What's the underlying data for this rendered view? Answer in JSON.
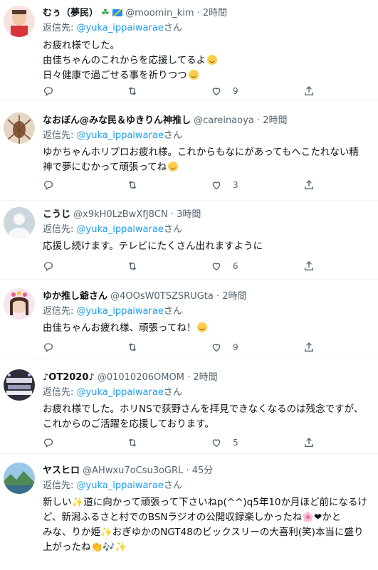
{
  "tweets": [
    {
      "name": "むぅ（夢民）",
      "handle": "@moomin_kim",
      "time": "2時間",
      "reply_prefix": "返信先:",
      "reply_handle": "@yuka_ippaiwarae",
      "reply_suffix": "さん",
      "lines": [
        "お疲れ様でした。",
        "由佳ちゃんのこれからを応援してるよ",
        "日々健康で過ごせる事を祈りつつ"
      ],
      "like_count": "9",
      "avatar_color": "#d9343c"
    },
    {
      "name": "なおぼん@みな民＆ゆきりん神推し",
      "handle": "@careinaoya",
      "time": "2時間",
      "reply_prefix": "返信先:",
      "reply_handle": "@yuka_ippaiwarae",
      "reply_suffix": "さん",
      "lines": [
        "ゆかちゃんホリプロお疲れ様。これからもなにがあってもへこたれない精",
        "神で夢にむかって頑張ってね"
      ],
      "like_count": "3",
      "avatar_color": "#c9aa8a"
    },
    {
      "name": "こうじ",
      "handle": "@x9kH0LzBwXfJ8CN",
      "time": "3時間",
      "reply_prefix": "返信先:",
      "reply_handle": "@yuka_ippaiwarae",
      "reply_suffix": "さん",
      "lines": [
        "応援し続けます。テレビにたくさん出れますように"
      ],
      "like_count": "6",
      "avatar_color": "#ccd6dd"
    },
    {
      "name": "ゆか推し爺さん",
      "handle": "@4OOsW0TSZSRUGta",
      "time": "2時間",
      "reply_prefix": "返信先:",
      "reply_handle": "@yuka_ippaiwarae",
      "reply_suffix": "さん",
      "lines": [
        "由佳ちゃんお疲れ様、頑張ってね！"
      ],
      "like_count": "9",
      "avatar_color": "#e8c9b8"
    },
    {
      "name": "♪OT2020♪",
      "handle": "@01010206OMOM",
      "time": "2時間",
      "reply_prefix": "返信先:",
      "reply_handle": "@yuka_ippaiwarae",
      "reply_suffix": "さん",
      "lines": [
        "お疲れ様でした。ホリNSで荻野さんを拝見できなくなるのは残念ですが、",
        "これからのご活躍を応援しております。"
      ],
      "like_count": "5",
      "avatar_color": "#4a4a5a"
    },
    {
      "name": "ヤスヒロ",
      "handle": "@AHwxu7oCsu3oGRL",
      "time": "45分",
      "reply_prefix": "返信先:",
      "reply_handle": "@yuka_ippaiwarae",
      "reply_suffix": "さん",
      "lines": [
        "新しい✨道に向かって頑張って下さいねp(^^)q5年10か月ほど前になるけ",
        "ど、新潟ふるさと村でのBSNラジオの公開収録楽しかったね🌸❤かと",
        "みな、りか姫✨おぎゆかのNGT48のビックスリーの大喜利(笑)本当に盛り",
        "上がったね👏🎶✨"
      ],
      "like_count": "",
      "avatar_color": "#5a9a6a"
    }
  ],
  "colors": {
    "link": "#1d9bf0",
    "secondary": "#536471",
    "text": "#0f1419",
    "divider": "#eff3f4"
  },
  "icons": [
    "reply-icon",
    "retweet-icon",
    "like-icon",
    "share-icon"
  ]
}
